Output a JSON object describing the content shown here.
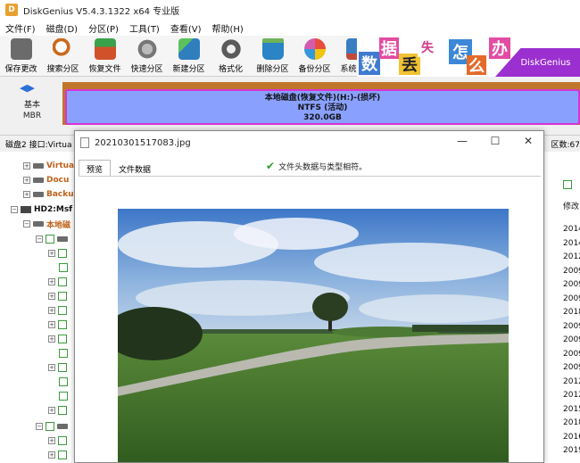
{
  "app": {
    "title": "DiskGenius V5.4.3.1322 x64 专业版"
  },
  "menu": [
    {
      "label": "文件(F)"
    },
    {
      "label": "磁盘(D)"
    },
    {
      "label": "分区(P)"
    },
    {
      "label": "工具(T)"
    },
    {
      "label": "查看(V)"
    },
    {
      "label": "帮助(H)"
    }
  ],
  "toolbar": [
    {
      "label": "保存更改",
      "icon": "save-icon",
      "color": "#6b6b6b"
    },
    {
      "label": "搜索分区",
      "icon": "search-icon",
      "color": "#c96a1b"
    },
    {
      "label": "恢复文件",
      "icon": "recover-icon",
      "color": "#d0522a"
    },
    {
      "label": "快速分区",
      "icon": "quick-partition-icon",
      "color": "#8a8a8a"
    },
    {
      "label": "新建分区",
      "icon": "new-partition-icon",
      "color": "#2f7fbf"
    },
    {
      "label": "格式化",
      "icon": "format-icon",
      "color": "#5b5b5b"
    },
    {
      "label": "删除分区",
      "icon": "delete-partition-icon",
      "color": "#2a84c6"
    },
    {
      "label": "备份分区",
      "icon": "backup-icon",
      "color": "#d45bb0"
    },
    {
      "label": "系统迁移",
      "icon": "migrate-icon",
      "color": "#3a7ec2"
    }
  ],
  "banner": {
    "chars": [
      "数",
      "据",
      "丢",
      "失",
      "怎",
      "么",
      "办"
    ],
    "brand": "DiskGenius"
  },
  "disk": {
    "basic_label": "基本",
    "mbr_label": "MBR",
    "partition_line1": "本地磁盘(恢复文件)(H:)-(损坏)",
    "partition_line2": "NTFS (活动)",
    "partition_line3": "320.0GB"
  },
  "infobar": {
    "text": "磁盘2 接口:Virtua",
    "right": "区数:67"
  },
  "tree": [
    {
      "label": "Virtua"
    },
    {
      "label": "Docu"
    },
    {
      "label": "Backu"
    },
    {
      "label": "HD2:Msf"
    },
    {
      "label": "本地磁"
    }
  ],
  "right_column": {
    "header": "修改",
    "years": [
      "2014",
      "2014",
      "2012",
      "2009",
      "2009",
      "2009",
      "2018",
      "2009",
      "2009",
      "2009",
      "2009",
      "2012",
      "2012",
      "2015",
      "2018",
      "2016",
      "2019"
    ]
  },
  "dialog": {
    "title": "20210301517083.jpg",
    "tabs": [
      {
        "label": "预览"
      },
      {
        "label": "文件数据"
      }
    ],
    "status": "文件头数据与类型相符。",
    "minimize": "—",
    "maximize": "☐",
    "close": "✕"
  },
  "colors": {
    "partition_fill": "#8aa0ff",
    "partition_border": "#d633d6",
    "disk_bar": "#c0762a",
    "tree_orange": "#c0611a"
  }
}
